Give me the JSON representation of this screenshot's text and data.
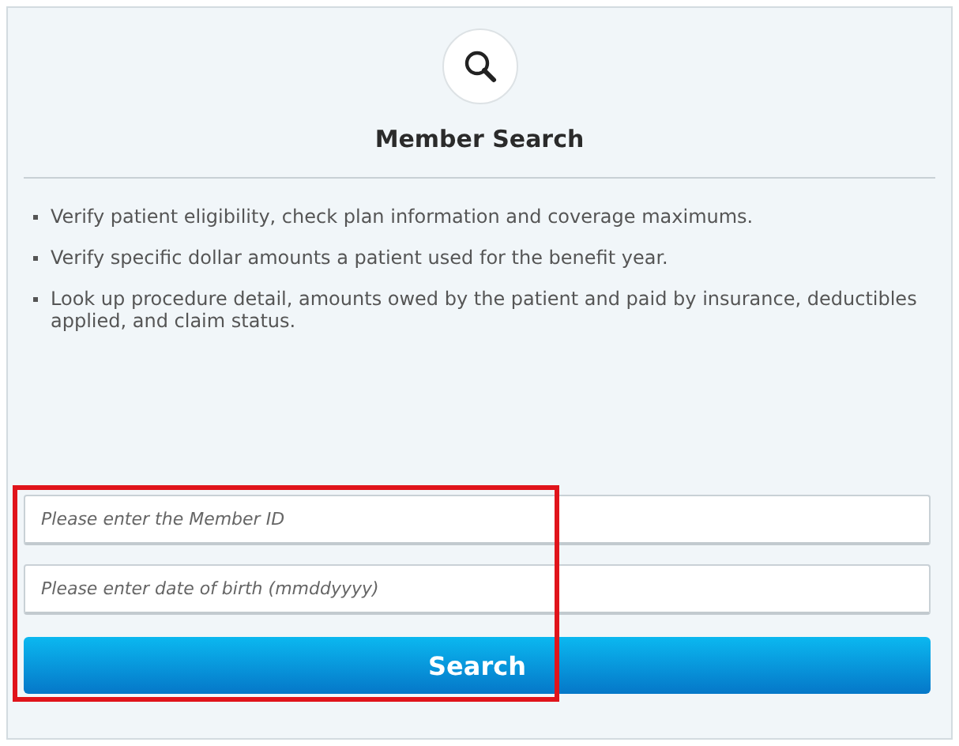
{
  "title": "Member Search",
  "bullets": [
    "Verify patient eligibility, check plan information and coverage maximums.",
    "Verify specific dollar amounts a patient used for the benefit year.",
    "Look up procedure detail, amounts owed by the patient and paid by insurance, deductibles applied, and claim status."
  ],
  "fields": [
    {
      "placeholder": "Please enter the Member ID"
    },
    {
      "placeholder": "Please enter date of birth (mmddyyyy)"
    }
  ],
  "button": "Search"
}
